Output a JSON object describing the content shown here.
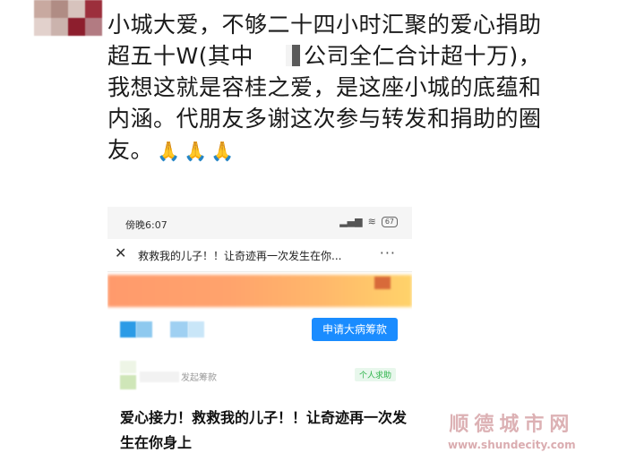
{
  "post": {
    "line1": "小城大爱，不够二十四小时汇聚的爱心捐助",
    "line2a": "超五十W(其中",
    "line2b": "公司全仁合计超十万)，",
    "line3": "我想这就是容桂之爱，是这座小城的底蕴和",
    "line4": "内涵。代朋友多谢这次参与转发和捐助的圈",
    "line5": "友。",
    "emoji": "🙏🙏🙏"
  },
  "avatar_colors": [
    "#c8a9a0",
    "#b08c84",
    "#d7c3bd",
    "#9c2f3c",
    "#e2d1cc",
    "#cbb3ad",
    "#8d1e2d",
    "#b27b82"
  ],
  "screenshot": {
    "status_time": "傍晚6:07",
    "battery": "67",
    "title": "救救我的儿子！！让奇迹再一次发生在你...",
    "apply_button": "申请大病筹款",
    "info_label": "发起筹款",
    "tag": "个人求助",
    "headline": "爱心接力！救救我的儿子！！让奇迹再一次发生在你身上"
  },
  "watermark": {
    "cn": "顺德城市网",
    "url": "www.shundecity.com"
  },
  "colors": {
    "accent": "#1a8cff",
    "tag_green": "#2db34a",
    "banner_start": "#ff9a6c",
    "banner_end": "#ffd36a"
  }
}
